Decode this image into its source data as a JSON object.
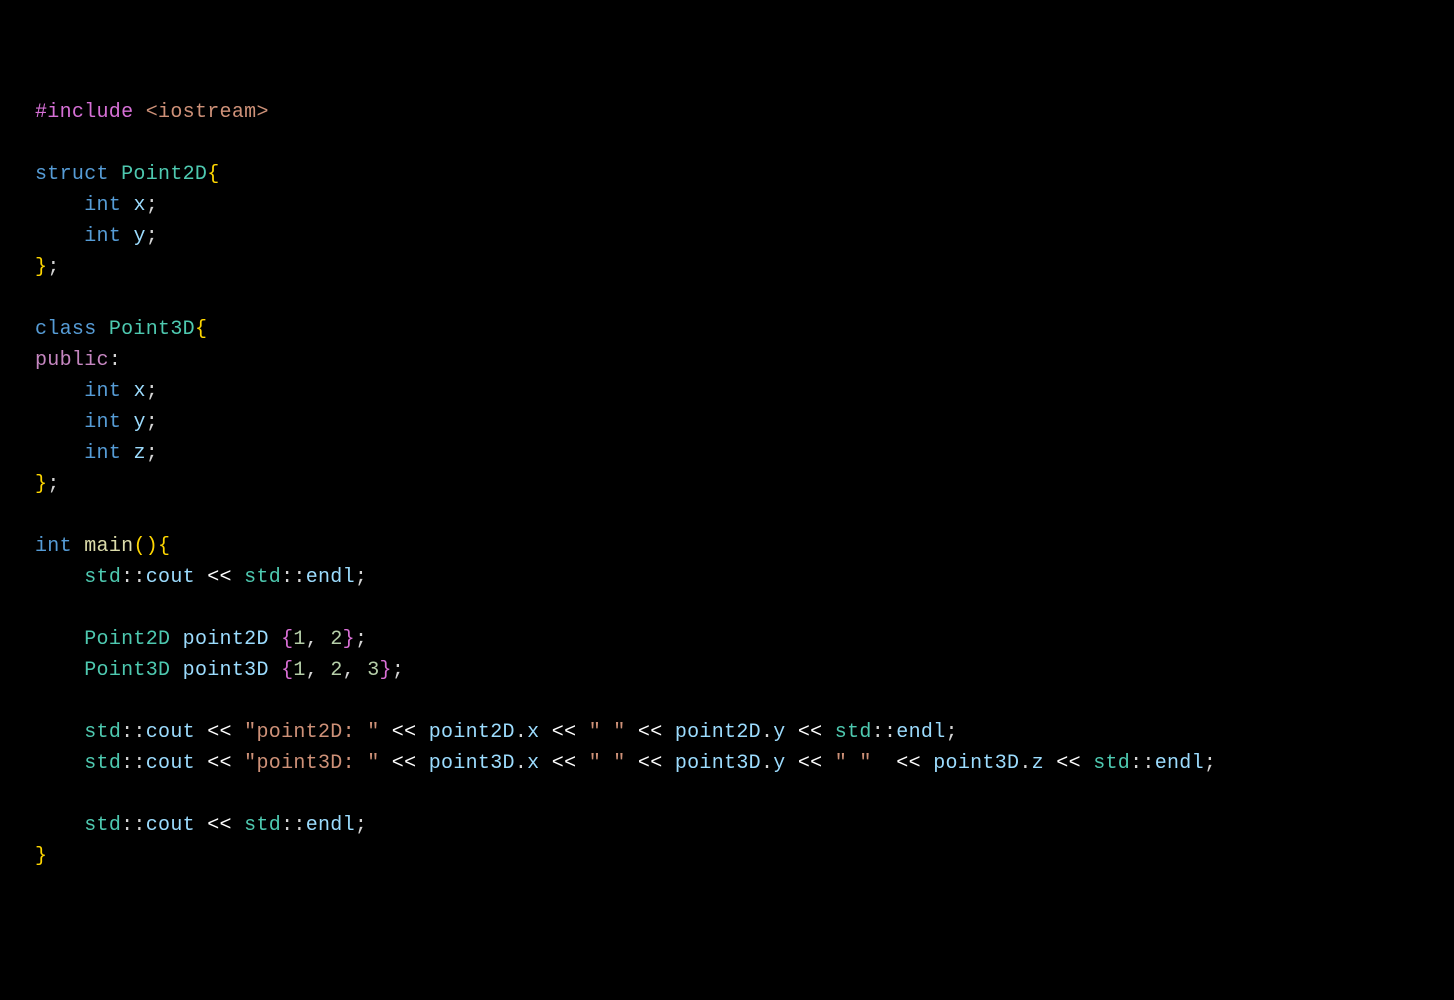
{
  "code": {
    "line1": {
      "preproc": "#include",
      "header": "<iostream>"
    },
    "line3": {
      "kw": "struct",
      "name": "Point2D",
      "brace": "{"
    },
    "line4": {
      "indent": "    ",
      "type": "int",
      "name": "x",
      "semi": ";"
    },
    "line5": {
      "indent": "    ",
      "type": "int",
      "name": "y",
      "semi": ";"
    },
    "line6": {
      "brace": "}",
      "semi": ";"
    },
    "line8": {
      "kw": "class",
      "name": "Point3D",
      "brace": "{"
    },
    "line9": {
      "kw": "public",
      "colon": ":"
    },
    "line10": {
      "indent": "    ",
      "type": "int",
      "name": "x",
      "semi": ";"
    },
    "line11": {
      "indent": "    ",
      "type": "int",
      "name": "y",
      "semi": ";"
    },
    "line12": {
      "indent": "    ",
      "type": "int",
      "name": "z",
      "semi": ";"
    },
    "line13": {
      "brace": "}",
      "semi": ";"
    },
    "line15": {
      "type": "int",
      "name": "main",
      "parens": "()",
      "brace": "{"
    },
    "line16": {
      "indent": "    ",
      "ns": "std",
      "dcolon": "::",
      "cout": "cout",
      "op": " << ",
      "ns2": "std",
      "dcolon2": "::",
      "endl": "endl",
      "semi": ";"
    },
    "line18": {
      "indent": "    ",
      "type": "Point2D",
      "name": "point2D",
      "brace_open": " {",
      "v1": "1",
      "comma": ", ",
      "v2": "2",
      "brace_close": "}",
      "semi": ";"
    },
    "line19": {
      "indent": "    ",
      "type": "Point3D",
      "name": "point3D",
      "brace_open": " {",
      "v1": "1",
      "comma": ", ",
      "v2": "2",
      "comma2": ", ",
      "v3": "3",
      "brace_close": "}",
      "semi": ";"
    },
    "line21": {
      "indent": "    ",
      "ns": "std",
      "dcolon": "::",
      "cout": "cout",
      "op1": " << ",
      "str1": "\"point2D: \"",
      "op2": " << ",
      "obj1": "point2D",
      "dot1": ".",
      "mem1": "x",
      "op3": " << ",
      "str2": "\" \"",
      "op4": " << ",
      "obj2": "point2D",
      "dot2": ".",
      "mem2": "y",
      "op5": " << ",
      "ns2": "std",
      "dcolon2": "::",
      "endl": "endl",
      "semi": ";"
    },
    "line22": {
      "indent": "    ",
      "ns": "std",
      "dcolon": "::",
      "cout": "cout",
      "op1": " << ",
      "str1": "\"point3D: \"",
      "op2": " << ",
      "obj1": "point3D",
      "dot1": ".",
      "mem1": "x",
      "op3": " << ",
      "str2": "\" \"",
      "op4": " << ",
      "obj2": "point3D",
      "dot2": ".",
      "mem2": "y",
      "op5": " << ",
      "str3": "\" \" ",
      "op6": " << ",
      "obj3": "point3D",
      "dot3": ".",
      "mem3": "z",
      "op7": " << ",
      "ns2": "std",
      "dcolon2": "::",
      "endl": "endl",
      "semi": ";"
    },
    "line24": {
      "indent": "    ",
      "ns": "std",
      "dcolon": "::",
      "cout": "cout",
      "op": " << ",
      "ns2": "std",
      "dcolon2": "::",
      "endl": "endl",
      "semi": ";"
    },
    "line25": {
      "brace": "}"
    }
  }
}
